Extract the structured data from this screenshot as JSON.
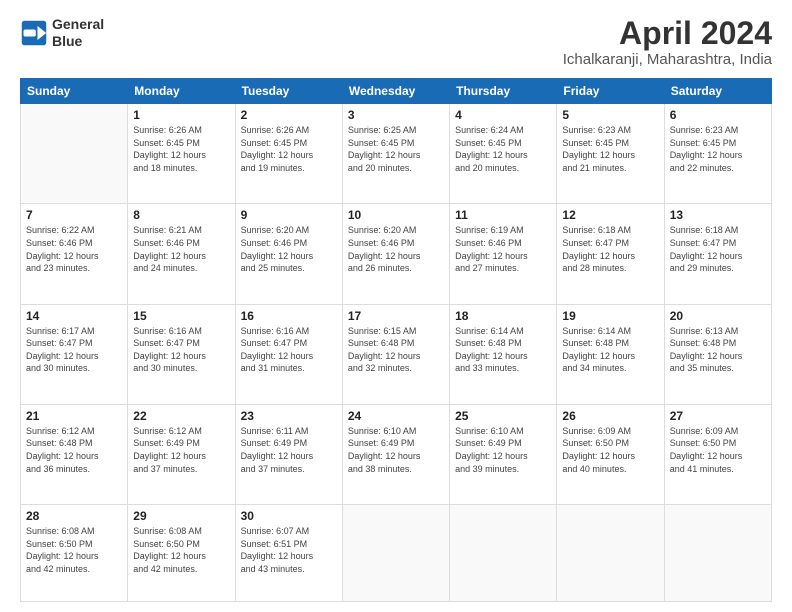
{
  "logo": {
    "line1": "General",
    "line2": "Blue"
  },
  "title": "April 2024",
  "subtitle": "Ichalkaranji, Maharashtra, India",
  "days_of_week": [
    "Sunday",
    "Monday",
    "Tuesday",
    "Wednesday",
    "Thursday",
    "Friday",
    "Saturday"
  ],
  "weeks": [
    [
      {
        "day": "",
        "sunrise": "",
        "sunset": "",
        "daylight": ""
      },
      {
        "day": "1",
        "sunrise": "Sunrise: 6:26 AM",
        "sunset": "Sunset: 6:45 PM",
        "daylight": "Daylight: 12 hours and 18 minutes."
      },
      {
        "day": "2",
        "sunrise": "Sunrise: 6:26 AM",
        "sunset": "Sunset: 6:45 PM",
        "daylight": "Daylight: 12 hours and 19 minutes."
      },
      {
        "day": "3",
        "sunrise": "Sunrise: 6:25 AM",
        "sunset": "Sunset: 6:45 PM",
        "daylight": "Daylight: 12 hours and 20 minutes."
      },
      {
        "day": "4",
        "sunrise": "Sunrise: 6:24 AM",
        "sunset": "Sunset: 6:45 PM",
        "daylight": "Daylight: 12 hours and 20 minutes."
      },
      {
        "day": "5",
        "sunrise": "Sunrise: 6:23 AM",
        "sunset": "Sunset: 6:45 PM",
        "daylight": "Daylight: 12 hours and 21 minutes."
      },
      {
        "day": "6",
        "sunrise": "Sunrise: 6:23 AM",
        "sunset": "Sunset: 6:45 PM",
        "daylight": "Daylight: 12 hours and 22 minutes."
      }
    ],
    [
      {
        "day": "7",
        "sunrise": "Sunrise: 6:22 AM",
        "sunset": "Sunset: 6:46 PM",
        "daylight": "Daylight: 12 hours and 23 minutes."
      },
      {
        "day": "8",
        "sunrise": "Sunrise: 6:21 AM",
        "sunset": "Sunset: 6:46 PM",
        "daylight": "Daylight: 12 hours and 24 minutes."
      },
      {
        "day": "9",
        "sunrise": "Sunrise: 6:20 AM",
        "sunset": "Sunset: 6:46 PM",
        "daylight": "Daylight: 12 hours and 25 minutes."
      },
      {
        "day": "10",
        "sunrise": "Sunrise: 6:20 AM",
        "sunset": "Sunset: 6:46 PM",
        "daylight": "Daylight: 12 hours and 26 minutes."
      },
      {
        "day": "11",
        "sunrise": "Sunrise: 6:19 AM",
        "sunset": "Sunset: 6:46 PM",
        "daylight": "Daylight: 12 hours and 27 minutes."
      },
      {
        "day": "12",
        "sunrise": "Sunrise: 6:18 AM",
        "sunset": "Sunset: 6:47 PM",
        "daylight": "Daylight: 12 hours and 28 minutes."
      },
      {
        "day": "13",
        "sunrise": "Sunrise: 6:18 AM",
        "sunset": "Sunset: 6:47 PM",
        "daylight": "Daylight: 12 hours and 29 minutes."
      }
    ],
    [
      {
        "day": "14",
        "sunrise": "Sunrise: 6:17 AM",
        "sunset": "Sunset: 6:47 PM",
        "daylight": "Daylight: 12 hours and 30 minutes."
      },
      {
        "day": "15",
        "sunrise": "Sunrise: 6:16 AM",
        "sunset": "Sunset: 6:47 PM",
        "daylight": "Daylight: 12 hours and 30 minutes."
      },
      {
        "day": "16",
        "sunrise": "Sunrise: 6:16 AM",
        "sunset": "Sunset: 6:47 PM",
        "daylight": "Daylight: 12 hours and 31 minutes."
      },
      {
        "day": "17",
        "sunrise": "Sunrise: 6:15 AM",
        "sunset": "Sunset: 6:48 PM",
        "daylight": "Daylight: 12 hours and 32 minutes."
      },
      {
        "day": "18",
        "sunrise": "Sunrise: 6:14 AM",
        "sunset": "Sunset: 6:48 PM",
        "daylight": "Daylight: 12 hours and 33 minutes."
      },
      {
        "day": "19",
        "sunrise": "Sunrise: 6:14 AM",
        "sunset": "Sunset: 6:48 PM",
        "daylight": "Daylight: 12 hours and 34 minutes."
      },
      {
        "day": "20",
        "sunrise": "Sunrise: 6:13 AM",
        "sunset": "Sunset: 6:48 PM",
        "daylight": "Daylight: 12 hours and 35 minutes."
      }
    ],
    [
      {
        "day": "21",
        "sunrise": "Sunrise: 6:12 AM",
        "sunset": "Sunset: 6:48 PM",
        "daylight": "Daylight: 12 hours and 36 minutes."
      },
      {
        "day": "22",
        "sunrise": "Sunrise: 6:12 AM",
        "sunset": "Sunset: 6:49 PM",
        "daylight": "Daylight: 12 hours and 37 minutes."
      },
      {
        "day": "23",
        "sunrise": "Sunrise: 6:11 AM",
        "sunset": "Sunset: 6:49 PM",
        "daylight": "Daylight: 12 hours and 37 minutes."
      },
      {
        "day": "24",
        "sunrise": "Sunrise: 6:10 AM",
        "sunset": "Sunset: 6:49 PM",
        "daylight": "Daylight: 12 hours and 38 minutes."
      },
      {
        "day": "25",
        "sunrise": "Sunrise: 6:10 AM",
        "sunset": "Sunset: 6:49 PM",
        "daylight": "Daylight: 12 hours and 39 minutes."
      },
      {
        "day": "26",
        "sunrise": "Sunrise: 6:09 AM",
        "sunset": "Sunset: 6:50 PM",
        "daylight": "Daylight: 12 hours and 40 minutes."
      },
      {
        "day": "27",
        "sunrise": "Sunrise: 6:09 AM",
        "sunset": "Sunset: 6:50 PM",
        "daylight": "Daylight: 12 hours and 41 minutes."
      }
    ],
    [
      {
        "day": "28",
        "sunrise": "Sunrise: 6:08 AM",
        "sunset": "Sunset: 6:50 PM",
        "daylight": "Daylight: 12 hours and 42 minutes."
      },
      {
        "day": "29",
        "sunrise": "Sunrise: 6:08 AM",
        "sunset": "Sunset: 6:50 PM",
        "daylight": "Daylight: 12 hours and 42 minutes."
      },
      {
        "day": "30",
        "sunrise": "Sunrise: 6:07 AM",
        "sunset": "Sunset: 6:51 PM",
        "daylight": "Daylight: 12 hours and 43 minutes."
      },
      {
        "day": "",
        "sunrise": "",
        "sunset": "",
        "daylight": ""
      },
      {
        "day": "",
        "sunrise": "",
        "sunset": "",
        "daylight": ""
      },
      {
        "day": "",
        "sunrise": "",
        "sunset": "",
        "daylight": ""
      },
      {
        "day": "",
        "sunrise": "",
        "sunset": "",
        "daylight": ""
      }
    ]
  ]
}
